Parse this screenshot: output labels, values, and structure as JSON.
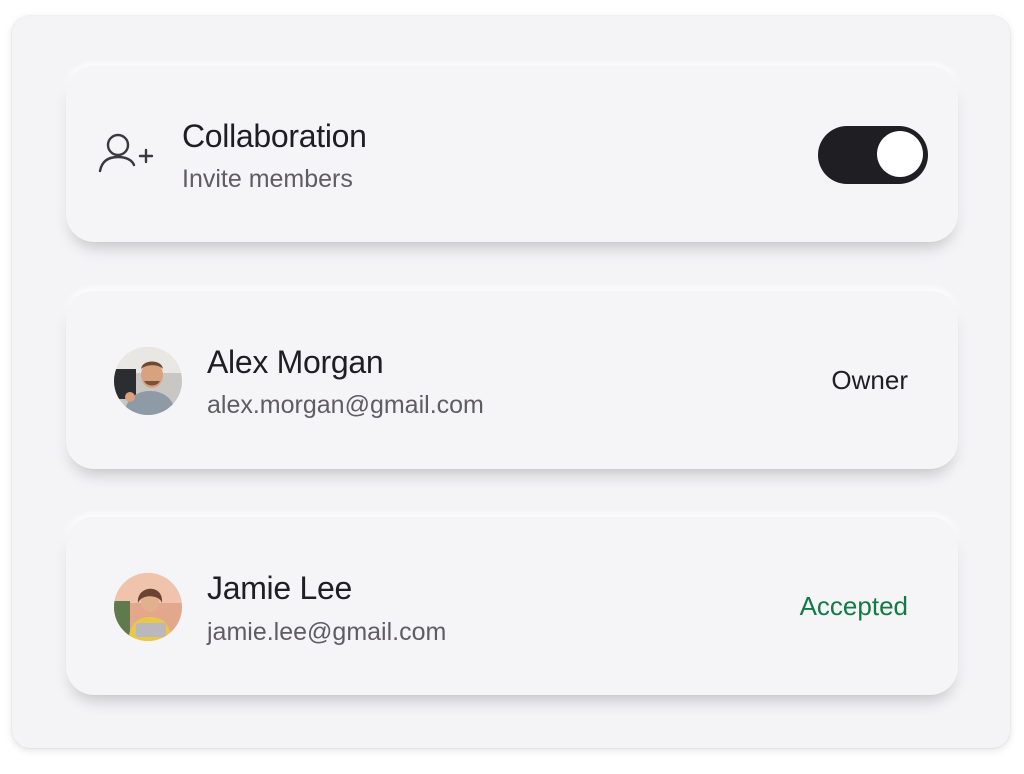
{
  "collaboration": {
    "icon": "add-user-icon",
    "title": "Collaboration",
    "subtitle": "Invite members",
    "toggle_on": true
  },
  "members": [
    {
      "name": "Alex Morgan",
      "email": "alex.morgan@gmail.com",
      "status": "Owner",
      "status_color": "#1f1e22"
    },
    {
      "name": "Jamie Lee",
      "email": "jamie.lee@gmail.com",
      "status": "Accepted",
      "status_color": "#137a45"
    }
  ],
  "colors": {
    "toggle_on": "#1f1e22",
    "accepted": "#137a45"
  }
}
